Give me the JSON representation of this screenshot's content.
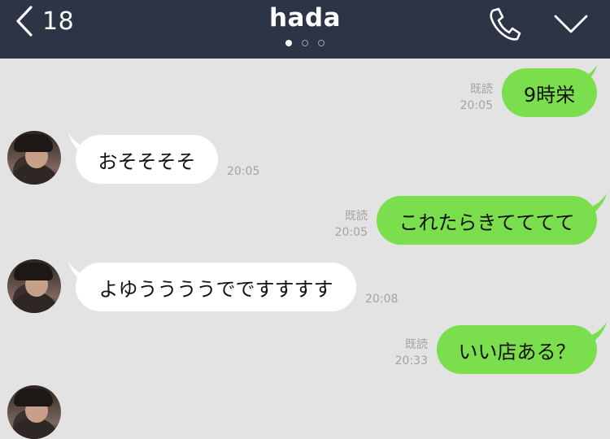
{
  "header": {
    "back_count": "18",
    "title": "hada",
    "page_indicator": {
      "count": 3,
      "active": 1
    }
  },
  "messages": [
    {
      "side": "right",
      "text": "9時栄",
      "read": "既読",
      "time": "20:05"
    },
    {
      "side": "left",
      "text": "おそそそそ",
      "time": "20:05"
    },
    {
      "side": "right",
      "text": "これたらきてててて",
      "read": "既読",
      "time": "20:05"
    },
    {
      "side": "left",
      "text": "よゆううううでですすすす",
      "time": "20:08"
    },
    {
      "side": "right",
      "text": "いい店ある？",
      "read": "既読",
      "time": "20:33"
    }
  ],
  "colors": {
    "header_bg": "#2c3445",
    "chat_bg": "#e3e3e3",
    "bubble_sent": "#7bde4d",
    "bubble_received": "#ffffff",
    "meta_text": "#a3a3a3"
  },
  "icons": {
    "back": "chevron-left-icon",
    "call": "phone-icon",
    "menu": "chevron-down-icon"
  }
}
